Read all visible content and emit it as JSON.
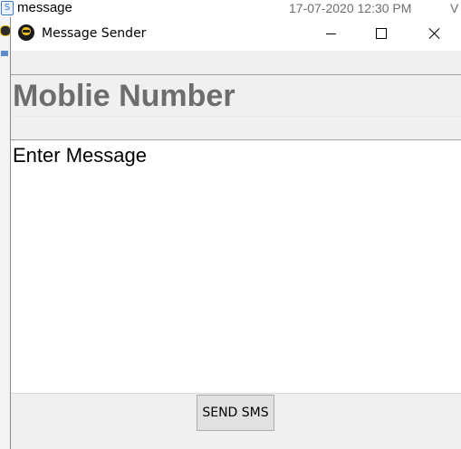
{
  "background": {
    "file_name": "message",
    "file_date": "17-07-2020 12:30 PM",
    "file_type_fragment": "V",
    "icon": "python-file-icon"
  },
  "window": {
    "title": "Message Sender",
    "app_icon": "app-logo-icon",
    "controls": {
      "minimize_icon": "minimize-icon",
      "maximize_icon": "maximize-icon",
      "close_icon": "close-icon"
    }
  },
  "form": {
    "mobile_placeholder": "Moblie Number",
    "message_placeholder": "Enter Message",
    "send_label": "SEND SMS"
  },
  "colors": {
    "placeholder_gray": "#6d6d6d",
    "window_bg": "#f0f0f0",
    "button_bg": "#e1e1e1"
  }
}
